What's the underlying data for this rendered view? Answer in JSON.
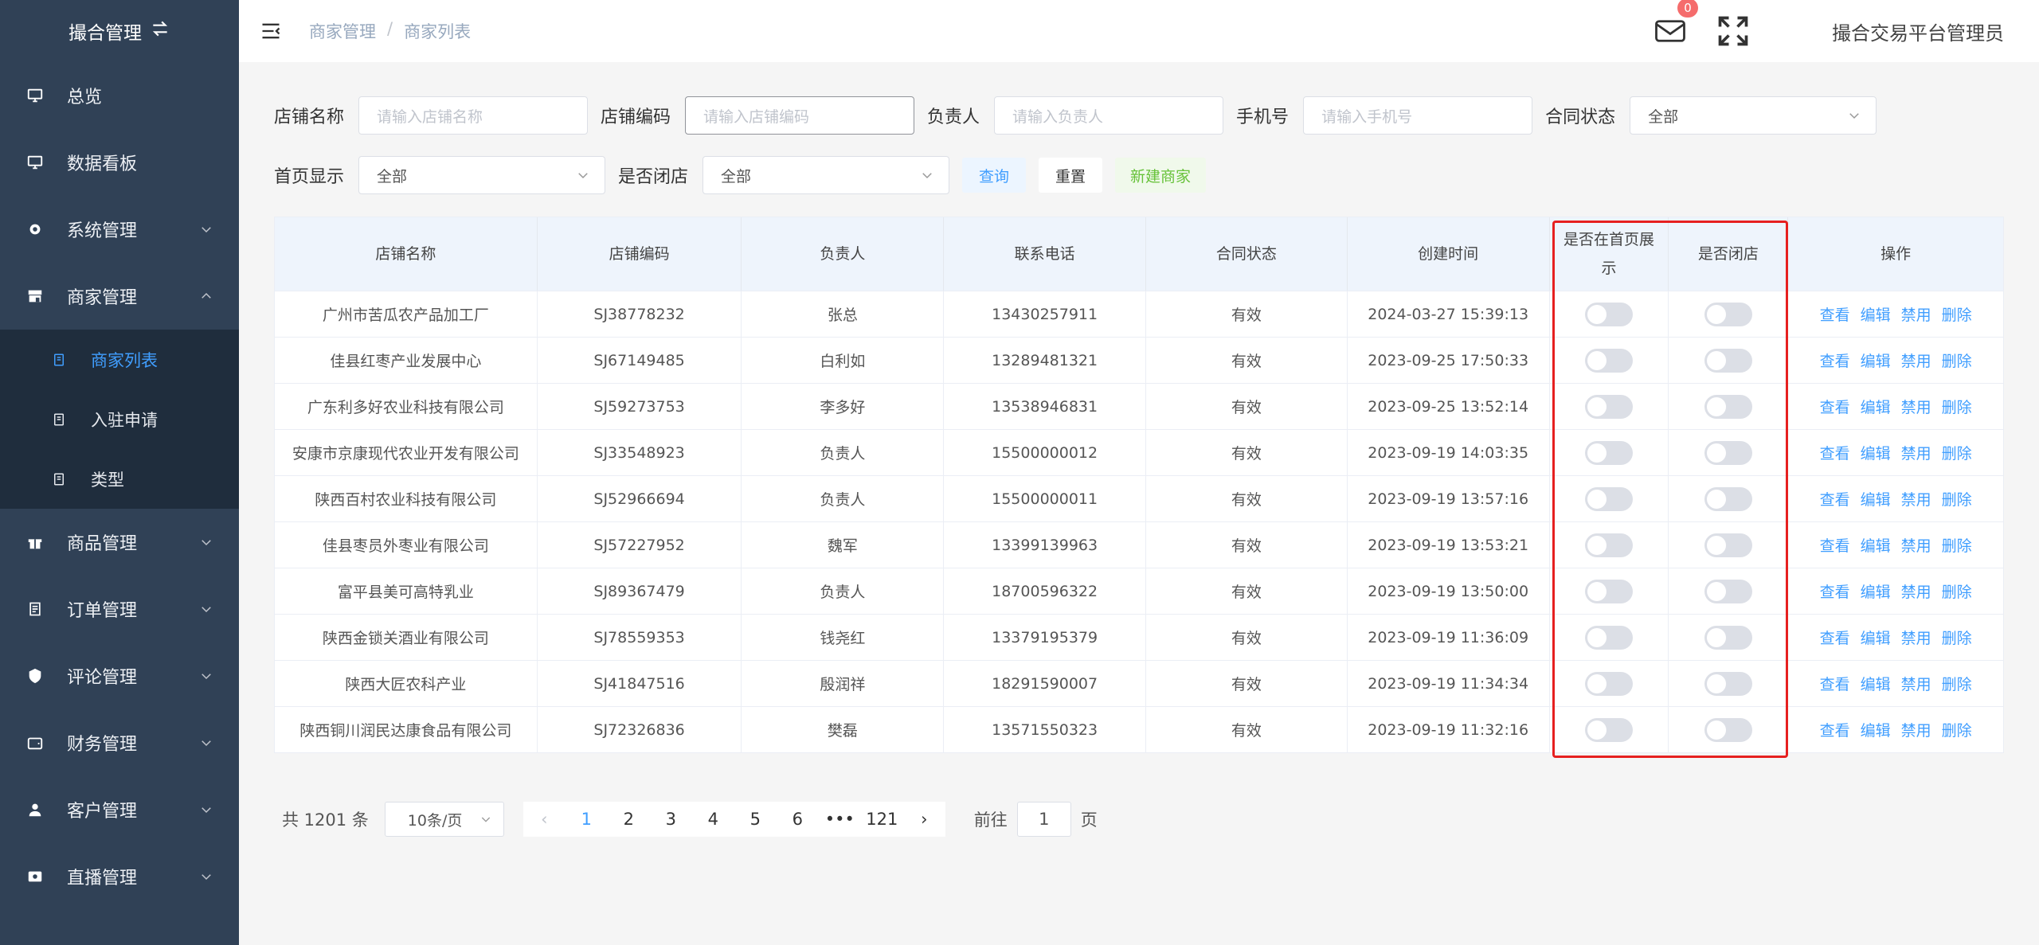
{
  "app": {
    "logo_text": "撮合管理",
    "logo_icon": "swap-icon"
  },
  "sidebar": {
    "items": [
      {
        "label": "总览",
        "icon": "monitor-icon",
        "has_children": false
      },
      {
        "label": "数据看板",
        "icon": "monitor-icon",
        "has_children": false
      },
      {
        "label": "系统管理",
        "icon": "gear-icon",
        "has_children": true
      },
      {
        "label": "商家管理",
        "icon": "store-icon",
        "has_children": true,
        "expanded": true
      },
      {
        "label": "商品管理",
        "icon": "gift-icon",
        "has_children": true
      },
      {
        "label": "订单管理",
        "icon": "list-icon",
        "has_children": true
      },
      {
        "label": "评论管理",
        "icon": "shield-icon",
        "has_children": true
      },
      {
        "label": "财务管理",
        "icon": "wallet-icon",
        "has_children": true
      },
      {
        "label": "客户管理",
        "icon": "user-icon",
        "has_children": true
      },
      {
        "label": "直播管理",
        "icon": "camera-icon",
        "has_children": true
      }
    ],
    "sub_items": [
      {
        "label": "商家列表",
        "active": true
      },
      {
        "label": "入驻申请",
        "active": false
      },
      {
        "label": "类型",
        "active": false
      }
    ]
  },
  "header": {
    "breadcrumb": [
      "商家管理",
      "商家列表"
    ],
    "breadcrumb_sep": "/",
    "mail_badge": "0",
    "username": "撮合交易平台管理员"
  },
  "search": {
    "shop_name_label": "店铺名称",
    "shop_name_placeholder": "请输入店铺名称",
    "shop_code_label": "店铺编码",
    "shop_code_placeholder": "请输入店铺编码",
    "owner_label": "负责人",
    "owner_placeholder": "请输入负责人",
    "phone_label": "手机号",
    "phone_placeholder": "请输入手机号",
    "contract_label": "合同状态",
    "contract_value": "全部",
    "homepage_label": "首页显示",
    "homepage_value": "全部",
    "closed_label": "是否闭店",
    "closed_value": "全部",
    "query_button": "查询",
    "reset_button": "重置",
    "new_button": "新建商家"
  },
  "table": {
    "headers": [
      "店铺名称",
      "店铺编码",
      "负责人",
      "联系电话",
      "合同状态",
      "创建时间",
      "是否在首页展示",
      "是否闭店",
      "操作"
    ],
    "actions": [
      "查看",
      "编辑",
      "禁用",
      "删除"
    ],
    "rows": [
      {
        "name": "广州市苦瓜农产品加工厂",
        "code": "SJ38778232",
        "owner": "张总",
        "phone": "13430257911",
        "status": "有效",
        "created": "2024-03-27 15:39:13",
        "homepage": false,
        "closed": false
      },
      {
        "name": "佳县红枣产业发展中心",
        "code": "SJ67149485",
        "owner": "白利如",
        "phone": "13289481321",
        "status": "有效",
        "created": "2023-09-25 17:50:33",
        "homepage": false,
        "closed": false
      },
      {
        "name": "广东利多好农业科技有限公司",
        "code": "SJ59273753",
        "owner": "李多好",
        "phone": "13538946831",
        "status": "有效",
        "created": "2023-09-25 13:52:14",
        "homepage": false,
        "closed": false
      },
      {
        "name": "安康市京康现代农业开发有限公司",
        "code": "SJ33548923",
        "owner": "负责人",
        "phone": "15500000012",
        "status": "有效",
        "created": "2023-09-19 14:03:35",
        "homepage": false,
        "closed": false
      },
      {
        "name": "陕西百村农业科技有限公司",
        "code": "SJ52966694",
        "owner": "负责人",
        "phone": "15500000011",
        "status": "有效",
        "created": "2023-09-19 13:57:16",
        "homepage": false,
        "closed": false
      },
      {
        "name": "佳县枣员外枣业有限公司",
        "code": "SJ57227952",
        "owner": "魏军",
        "phone": "13399139963",
        "status": "有效",
        "created": "2023-09-19 13:53:21",
        "homepage": false,
        "closed": false
      },
      {
        "name": "富平县美可高特乳业",
        "code": "SJ89367479",
        "owner": "负责人",
        "phone": "18700596322",
        "status": "有效",
        "created": "2023-09-19 13:50:00",
        "homepage": false,
        "closed": false
      },
      {
        "name": "陕西金锁关酒业有限公司",
        "code": "SJ78559353",
        "owner": "钱尧红",
        "phone": "13379195379",
        "status": "有效",
        "created": "2023-09-19 11:36:09",
        "homepage": false,
        "closed": false
      },
      {
        "name": "陕西大匠农科产业",
        "code": "SJ41847516",
        "owner": "殷润祥",
        "phone": "18291590007",
        "status": "有效",
        "created": "2023-09-19 11:34:34",
        "homepage": false,
        "closed": false
      },
      {
        "name": "陕西铜川润民达康食品有限公司",
        "code": "SJ72326836",
        "owner": "樊磊",
        "phone": "13571550323",
        "status": "有效",
        "created": "2023-09-19 11:32:16",
        "homepage": false,
        "closed": false
      }
    ]
  },
  "pagination": {
    "total": "共 1201 条",
    "page_size": "10条/页",
    "pages": [
      "1",
      "2",
      "3",
      "4",
      "5",
      "6",
      "•••",
      "121"
    ],
    "current": "1",
    "jump_prefix": "前往",
    "jump_value": "1",
    "jump_suffix": "页"
  },
  "colors": {
    "sidebar_bg": "#304156",
    "submenu_bg": "#1f2d3d",
    "accent": "#409eff",
    "highlight": "#e62020"
  }
}
